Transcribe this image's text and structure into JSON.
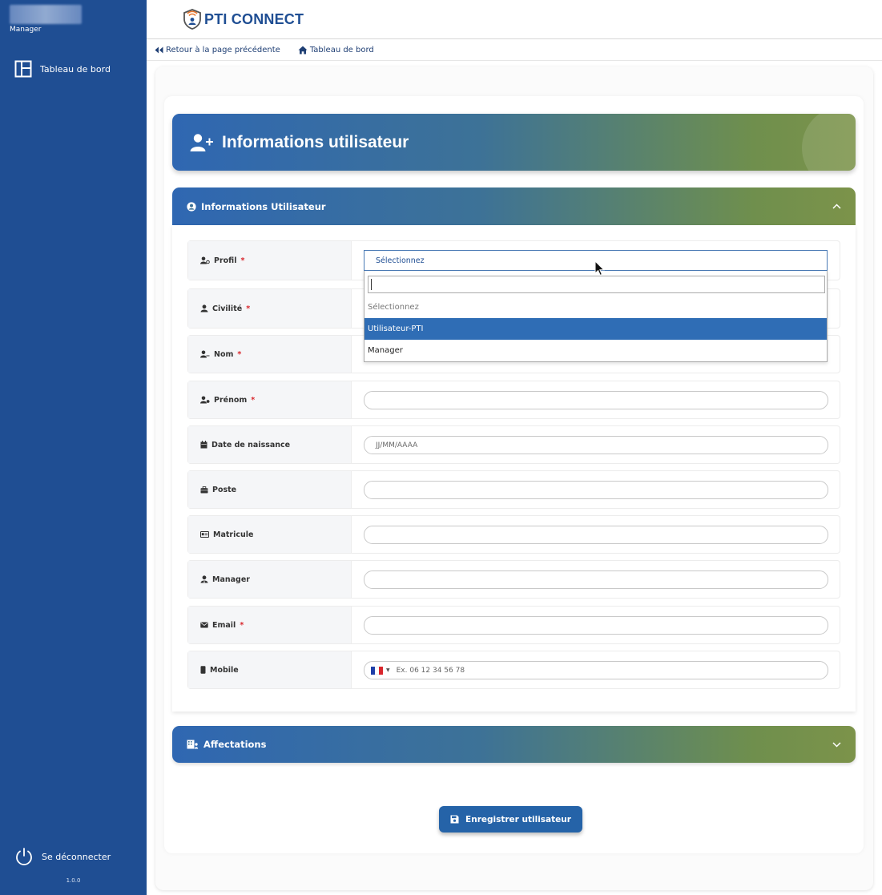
{
  "sidebar": {
    "role": "Manager",
    "nav": [
      {
        "label": "Tableau de bord"
      }
    ],
    "logout_label": "Se déconnecter",
    "version": "1.0.0"
  },
  "header": {
    "logo_text": "PTI CONNECT"
  },
  "breadcrumb": {
    "back_label": "Retour à la page précédente",
    "home_label": "Tableau de bord"
  },
  "page": {
    "title": "Informations utilisateur"
  },
  "sections": {
    "user_info": {
      "title": "Informations Utilisateur",
      "expanded": true
    },
    "assignments": {
      "title": "Affectations",
      "expanded": false
    }
  },
  "form": {
    "fields": [
      {
        "label": "Profil",
        "required": "*",
        "value": "",
        "placeholder": ""
      },
      {
        "label": "Civilité",
        "required": "*",
        "value": "",
        "placeholder": ""
      },
      {
        "label": "Nom",
        "required": "*",
        "value": "",
        "placeholder": ""
      },
      {
        "label": "Prénom",
        "required": "*",
        "value": "",
        "placeholder": ""
      },
      {
        "label": "Date de naissance",
        "required": "",
        "value": "",
        "placeholder": "JJ/MM/AAAA"
      },
      {
        "label": "Poste",
        "required": "",
        "value": "",
        "placeholder": ""
      },
      {
        "label": "Matricule",
        "required": "",
        "value": "",
        "placeholder": ""
      },
      {
        "label": "Manager",
        "required": "",
        "value": "",
        "placeholder": ""
      },
      {
        "label": "Email",
        "required": "*",
        "value": "",
        "placeholder": ""
      },
      {
        "label": "Mobile",
        "required": "",
        "value": "",
        "placeholder": "Ex. 06 12 34 56 78"
      }
    ],
    "profile_select": {
      "selected": "Sélectionnez",
      "search_value": "",
      "options": [
        "Sélectionnez",
        "Utilisateur-PTI",
        "Manager"
      ],
      "highlighted": "Utilisateur-PTI"
    }
  },
  "actions": {
    "save_label": "Enregistrer utilisateur"
  },
  "colors": {
    "sidebar": "#1f4e93",
    "gradient_start": "#2f67b2",
    "gradient_end": "#7c934a",
    "primary_button": "#2563a8",
    "required": "#d9262c"
  }
}
